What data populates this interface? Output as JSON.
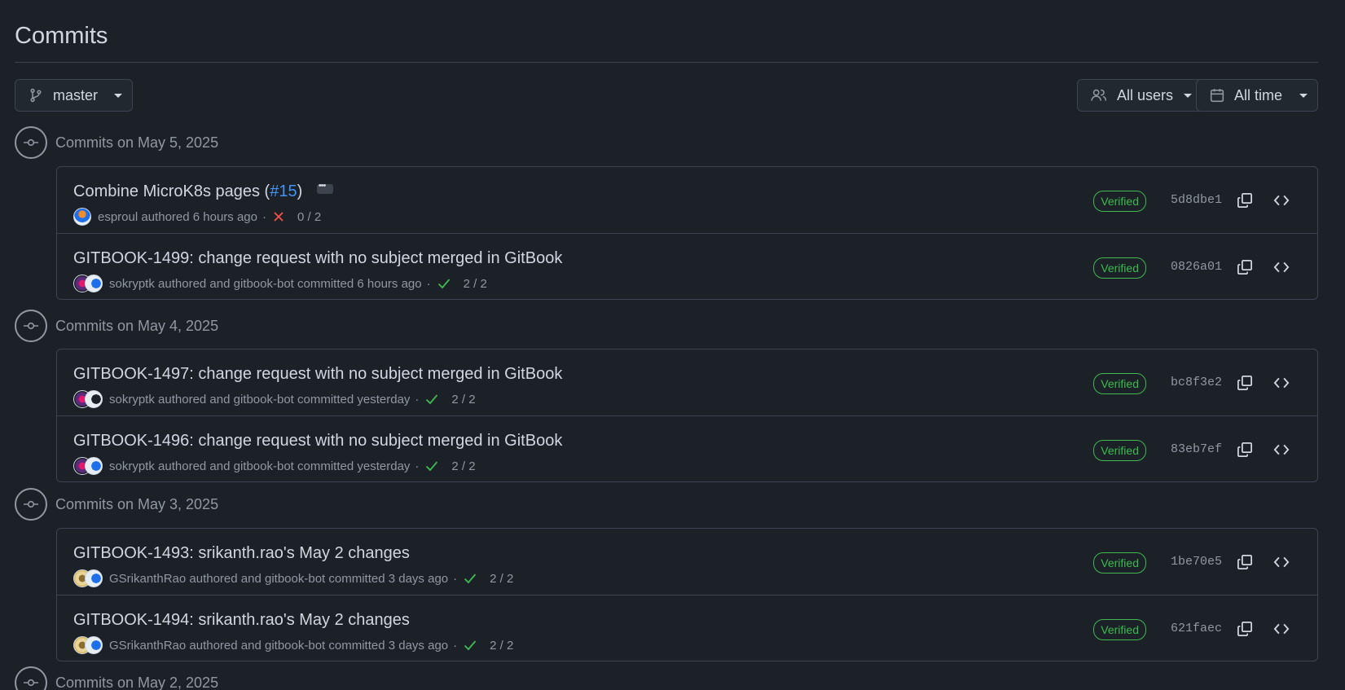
{
  "page": {
    "title": "Commits"
  },
  "filters": {
    "branch": "master",
    "users": "All users",
    "time": "All time"
  },
  "groups": [
    {
      "date": "Commits on May 5, 2025",
      "commits": [
        {
          "title": "Combine MicroK8s pages (",
          "pr": "#15",
          "title_end": ")",
          "author": "esproul",
          "action": "authored",
          "committer": "",
          "committer_action": "",
          "time": "6 hours ago",
          "status": "fail",
          "checks": "0 / 2",
          "verified": "Verified",
          "sha": "5d8dbe1"
        },
        {
          "title": "GITBOOK-1499: change request with no subject merged in GitBook",
          "author": "sokryptk",
          "action": "authored and",
          "committer": "gitbook-bot",
          "committer_action": "committed",
          "time": "6 hours ago",
          "status": "pass",
          "checks": "2 / 2",
          "verified": "Verified",
          "sha": "0826a01"
        }
      ]
    },
    {
      "date": "Commits on May 4, 2025",
      "commits": [
        {
          "title": "GITBOOK-1497: change request with no subject merged in GitBook",
          "author": "sokryptk",
          "action": "authored and",
          "committer": "gitbook-bot",
          "committer_action": "committed",
          "time": "yesterday",
          "status": "pass",
          "checks": "2 / 2",
          "verified": "Verified",
          "sha": "bc8f3e2"
        },
        {
          "title": "GITBOOK-1496: change request with no subject merged in GitBook",
          "author": "sokryptk",
          "action": "authored and",
          "committer": "gitbook-bot",
          "committer_action": "committed",
          "time": "yesterday",
          "status": "pass",
          "checks": "2 / 2",
          "verified": "Verified",
          "sha": "83eb7ef"
        }
      ]
    },
    {
      "date": "Commits on May 3, 2025",
      "commits": [
        {
          "title": "GITBOOK-1493: srikanth.rao's May 2 changes",
          "author": "GSrikanthRao",
          "action": "authored and",
          "committer": "gitbook-bot",
          "committer_action": "committed",
          "time": "3 days ago",
          "status": "pass",
          "checks": "2 / 2",
          "verified": "Verified",
          "sha": "1be70e5"
        },
        {
          "title": "GITBOOK-1494: srikanth.rao's May 2 changes",
          "author": "GSrikanthRao",
          "action": "authored and",
          "committer": "gitbook-bot",
          "committer_action": "committed",
          "time": "3 days ago",
          "status": "pass",
          "checks": "2 / 2",
          "verified": "Verified",
          "sha": "621faec"
        }
      ]
    },
    {
      "date": "Commits on May 2, 2025",
      "commits": []
    }
  ],
  "colors": {
    "accent_link": "#4493f8",
    "success": "#3fb950",
    "danger": "#f85149",
    "background": "#1c2128",
    "border": "#3d444d"
  }
}
